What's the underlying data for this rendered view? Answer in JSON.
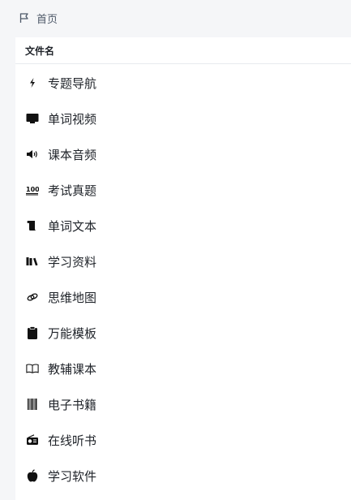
{
  "breadcrumb": {
    "icon": "flag-icon",
    "label": "首页"
  },
  "table": {
    "column_header": "文件名",
    "items": [
      {
        "label": "专题导航",
        "icon": "lightning-icon"
      },
      {
        "label": "单词视频",
        "icon": "monitor-icon"
      },
      {
        "label": "课本音频",
        "icon": "speaker-icon"
      },
      {
        "label": "考试真题",
        "icon": "hundred-points-icon"
      },
      {
        "label": "单词文本",
        "icon": "scroll-icon"
      },
      {
        "label": "学习资料",
        "icon": "books-icon"
      },
      {
        "label": "思维地图",
        "icon": "link-icon"
      },
      {
        "label": "万能模板",
        "icon": "clipboard-icon"
      },
      {
        "label": "教辅课本",
        "icon": "open-book-icon"
      },
      {
        "label": "电子书籍",
        "icon": "barcode-icon"
      },
      {
        "label": "在线听书",
        "icon": "radio-icon"
      },
      {
        "label": "学习软件",
        "icon": "apple-icon"
      }
    ]
  }
}
